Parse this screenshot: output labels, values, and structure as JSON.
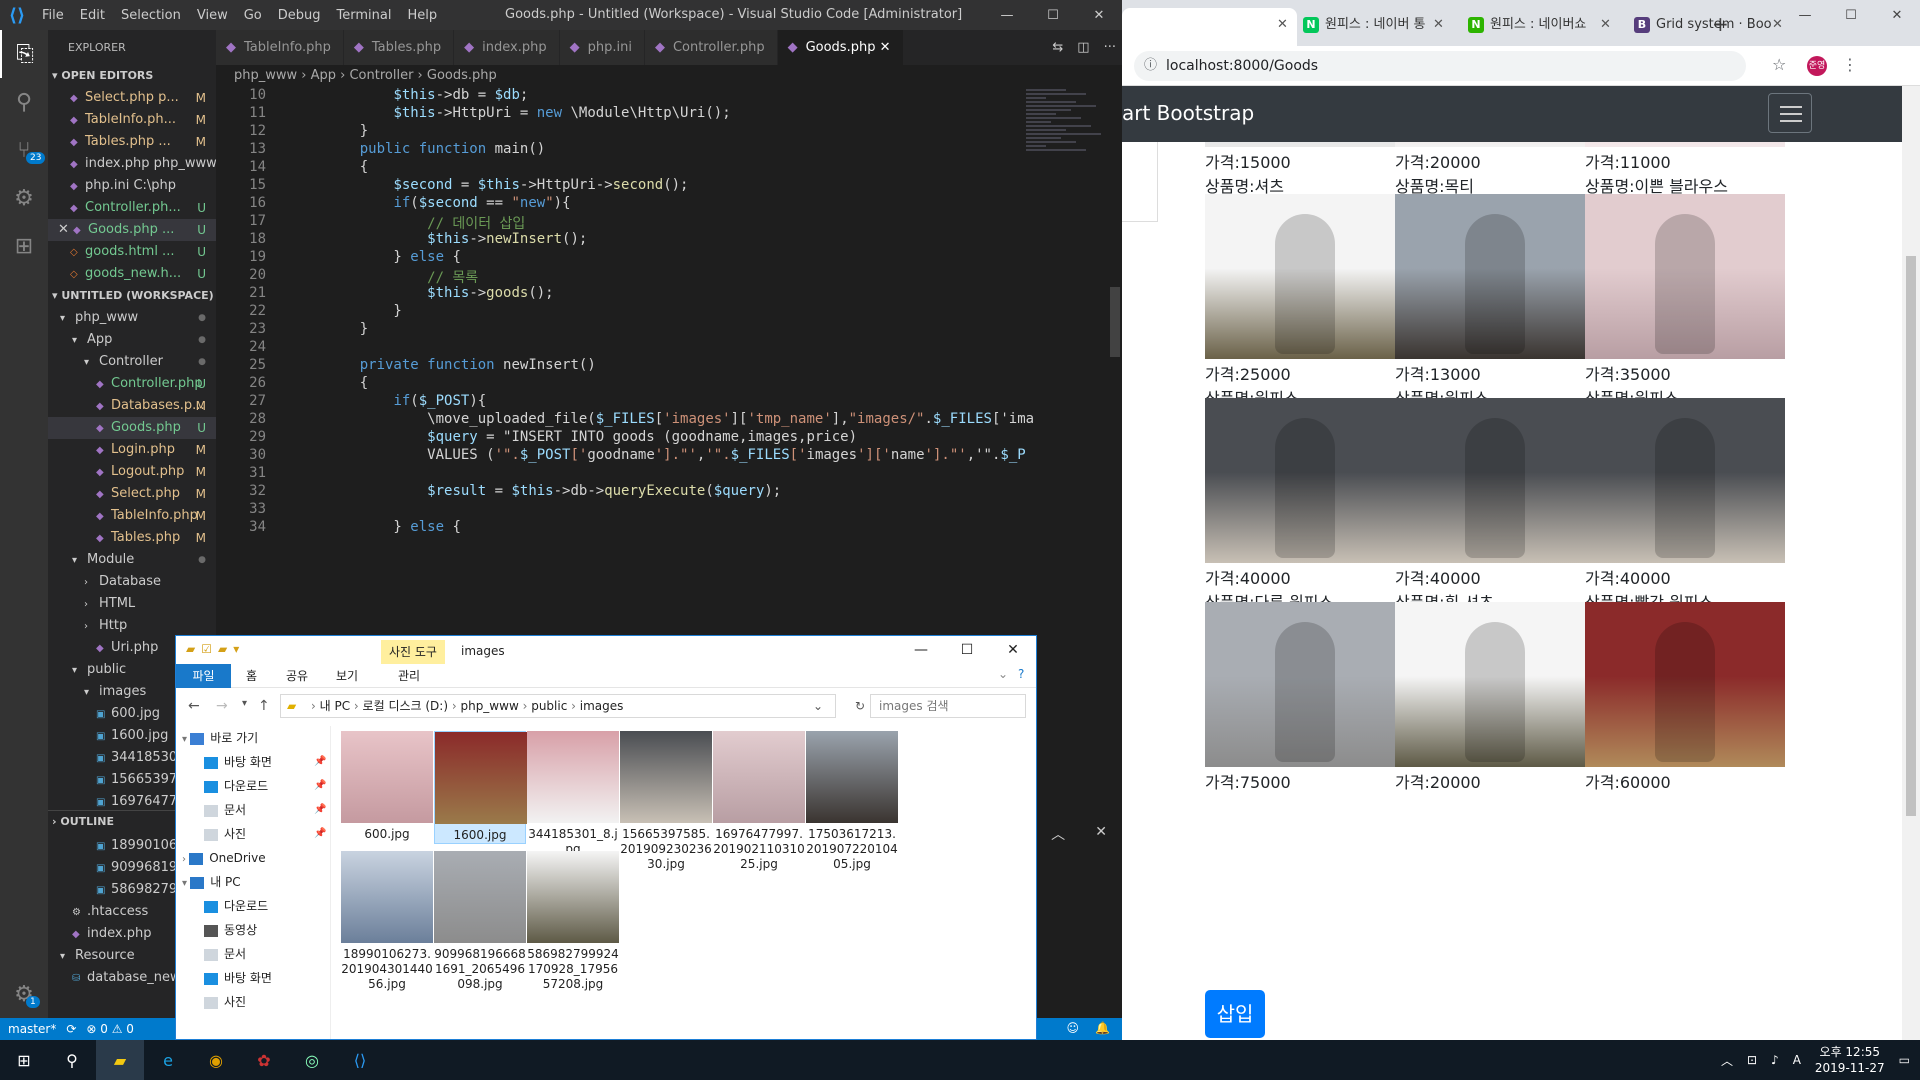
{
  "vscode": {
    "title": "Goods.php - Untitled (Workspace) - Visual Studio Code [Administrator]",
    "menu": [
      "File",
      "Edit",
      "Selection",
      "View",
      "Go",
      "Debug",
      "Terminal",
      "Help"
    ],
    "scm_badge": "23",
    "settings_badge": "1",
    "explorer_label": "EXPLORER",
    "open_editors_label": "OPEN EDITORS",
    "workspace_label": "UNTITLED (WORKSPACE)",
    "outline_label": "OUTLINE",
    "open_editors": [
      {
        "name": "Select.php p...",
        "status": "M",
        "type": "php"
      },
      {
        "name": "TableInfo.ph...",
        "status": "M",
        "type": "php"
      },
      {
        "name": "Tables.php ...",
        "status": "M",
        "type": "php"
      },
      {
        "name": "index.php  php_www...",
        "status": "",
        "type": "php"
      },
      {
        "name": "php.ini  C:\\php",
        "status": "",
        "type": "ini"
      },
      {
        "name": "Controller.ph...",
        "status": "U",
        "type": "php"
      },
      {
        "name": "Goods.php ...",
        "status": "U",
        "type": "php"
      },
      {
        "name": "goods.html ...",
        "status": "U",
        "type": "html"
      },
      {
        "name": "goods_new.h...",
        "status": "U",
        "type": "html"
      }
    ],
    "tree": [
      {
        "name": "php_www",
        "indent": 1,
        "kind": "folder"
      },
      {
        "name": "App",
        "indent": 2,
        "kind": "folder"
      },
      {
        "name": "Controller",
        "indent": 3,
        "kind": "folder"
      },
      {
        "name": "Controller.php",
        "indent": 4,
        "kind": "php",
        "status": "U"
      },
      {
        "name": "Databases.p...",
        "indent": 4,
        "kind": "php",
        "status": "M"
      },
      {
        "name": "Goods.php",
        "indent": 4,
        "kind": "php",
        "status": "U",
        "sel": true
      },
      {
        "name": "Login.php",
        "indent": 4,
        "kind": "php",
        "status": "M"
      },
      {
        "name": "Logout.php",
        "indent": 4,
        "kind": "php",
        "status": "M"
      },
      {
        "name": "Select.php",
        "indent": 4,
        "kind": "php",
        "status": "M"
      },
      {
        "name": "TableInfo.php",
        "indent": 4,
        "kind": "php",
        "status": "M"
      },
      {
        "name": "Tables.php",
        "indent": 4,
        "kind": "php",
        "status": "M"
      },
      {
        "name": "Module",
        "indent": 2,
        "kind": "folder"
      },
      {
        "name": "Database",
        "indent": 3,
        "kind": "folder-c"
      },
      {
        "name": "HTML",
        "indent": 3,
        "kind": "folder-c"
      },
      {
        "name": "Http",
        "indent": 3,
        "kind": "folder-c"
      },
      {
        "name": "Uri.php",
        "indent": 4,
        "kind": "php"
      },
      {
        "name": "public",
        "indent": 2,
        "kind": "folder"
      },
      {
        "name": "images",
        "indent": 3,
        "kind": "folder"
      },
      {
        "name": "600.jpg",
        "indent": 4,
        "kind": "img"
      },
      {
        "name": "1600.jpg",
        "indent": 4,
        "kind": "img"
      },
      {
        "name": "344185301_...",
        "indent": 4,
        "kind": "img"
      },
      {
        "name": "1566539758...",
        "indent": 4,
        "kind": "img"
      },
      {
        "name": "1697647799...",
        "indent": 4,
        "kind": "img"
      },
      {
        "name": "1750361721...",
        "indent": 4,
        "kind": "img"
      },
      {
        "name": "1899010627...",
        "indent": 4,
        "kind": "img"
      },
      {
        "name": "9099681966...",
        "indent": 4,
        "kind": "img"
      },
      {
        "name": "5869827999...",
        "indent": 4,
        "kind": "img"
      },
      {
        "name": ".htaccess",
        "indent": 2,
        "kind": "gear"
      },
      {
        "name": "index.php",
        "indent": 2,
        "kind": "php"
      },
      {
        "name": "Resource",
        "indent": 1,
        "kind": "folder"
      },
      {
        "name": "database_new...",
        "indent": 2,
        "kind": "db"
      }
    ],
    "tabs": [
      {
        "name": "TableInfo.php",
        "active": false
      },
      {
        "name": "Tables.php",
        "active": false
      },
      {
        "name": "index.php",
        "active": false
      },
      {
        "name": "php.ini",
        "active": false
      },
      {
        "name": "Controller.php",
        "active": false
      },
      {
        "name": "Goods.php",
        "active": true
      }
    ],
    "breadcrumb": "php_www › App › Controller › Goods.php",
    "line_numbers": [
      "10",
      "11",
      "12",
      "13",
      "14",
      "15",
      "16",
      "17",
      "18",
      "19",
      "20",
      "21",
      "22",
      "23",
      "24",
      "25",
      "26",
      "27",
      "28",
      "29",
      "30",
      "31",
      "32",
      "33",
      "34"
    ],
    "code": [
      "        $this->db = $db;",
      "        $this->HttpUri = new \\Module\\Http\\Uri();",
      "    }",
      "    public function main()",
      "    {",
      "        $second = $this->HttpUri->second();",
      "        if($second == \"new\"){",
      "            // 데이터 삽입",
      "            $this->newInsert();",
      "        } else {",
      "            // 목록",
      "            $this->goods();",
      "        }",
      "    }",
      "",
      "    private function newInsert()",
      "    {",
      "        if($_POST){",
      "            \\move_uploaded_file($_FILES['images']['tmp_name'],\"images/\".$_FILES['ima",
      "            $query = \"INSERT INTO goods (goodname,images,price)",
      "            VALUES ('\".$_POST['goodname'].\"','\".$_FILES['images']['name'].\"','\".$_P",
      "",
      "            $result = $this->db->queryExecute($query);",
      "",
      "        } else {"
    ],
    "status": {
      "branch": "master*",
      "sync": "⟳",
      "problems": "⊗ 0 ⚠ 0"
    }
  },
  "chrome": {
    "tabs": [
      {
        "title": "",
        "fav": "",
        "color": "#dee1e6"
      },
      {
        "title": "원피스 : 네이버 통",
        "fav": "N",
        "color": "#03c75a"
      },
      {
        "title": "원피스 : 네이버쇼",
        "fav": "N",
        "color": "#2db400"
      },
      {
        "title": "Grid system · Boo",
        "fav": "B",
        "color": "#563d7c"
      }
    ],
    "url": "localhost:8000/Goods",
    "profile": "준영",
    "brand": "art Bootstrap",
    "products": [
      {
        "price": "가격:15000",
        "name": "상품명:셔츠",
        "colors": [
          "#c9d3e0",
          "#e8e8e8"
        ]
      },
      {
        "price": "가격:20000",
        "name": "상품명:목티",
        "colors": [
          "#d8a0a8",
          "#f2f2f2"
        ]
      },
      {
        "price": "가격:11000",
        "name": "상품명:이쁜 블라우스",
        "colors": [
          "#e8c4c8",
          "#f3e8ea"
        ]
      },
      {
        "price": "가격:25000",
        "name": "상품명:원피스",
        "colors": [
          "#f4f4f4",
          "#6a6148"
        ]
      },
      {
        "price": "가격:13000",
        "name": "상품명:원피스",
        "colors": [
          "#9aa3ad",
          "#3a3430"
        ]
      },
      {
        "price": "가격:35000",
        "name": "상품명:원피스",
        "colors": [
          "#e2cccf",
          "#b89ea3"
        ]
      },
      {
        "price": "가격:40000",
        "name": "상품명:다른 원피스",
        "colors": [
          "#4a4d52",
          "#c8c0b5"
        ]
      },
      {
        "price": "가격:40000",
        "name": "상품명:흰 셔츠",
        "colors": [
          "#4a4d52",
          "#c8c0b5"
        ]
      },
      {
        "price": "가격:40000",
        "name": "상품명:빨간 원피스",
        "colors": [
          "#4a4d52",
          "#c8c0b5"
        ]
      },
      {
        "price": "가격:75000",
        "name": "",
        "colors": [
          "#a9adb3",
          "#8c8c8c"
        ]
      },
      {
        "price": "가격:20000",
        "name": "",
        "colors": [
          "#f5f5f5",
          "#5e5a46"
        ]
      },
      {
        "price": "가격:60000",
        "name": "",
        "colors": [
          "#8b2a2a",
          "#b08a5a"
        ]
      }
    ],
    "insert_button": "삽입"
  },
  "file_explorer": {
    "tool_tab": "사진 도구",
    "title": "images",
    "ribbon": [
      "파일",
      "홈",
      "공유",
      "보기",
      "관리"
    ],
    "path": [
      "내 PC",
      "로컬 디스크 (D:)",
      "php_www",
      "public",
      "images"
    ],
    "search_placeholder": "images 검색",
    "nav": [
      {
        "name": "바로 가기",
        "indent": 0,
        "icon": "#3b7fd4",
        "pin": false
      },
      {
        "name": "바탕 화면",
        "indent": 1,
        "icon": "#1a8fe0",
        "pin": true
      },
      {
        "name": "다운로드",
        "indent": 1,
        "icon": "#1a8fe0",
        "pin": true
      },
      {
        "name": "문서",
        "indent": 1,
        "icon": "#cfd6dd",
        "pin": true
      },
      {
        "name": "사진",
        "indent": 1,
        "icon": "#cfd6dd",
        "pin": true
      },
      {
        "name": "OneDrive",
        "indent": 0,
        "icon": "#2a78c8",
        "pin": false
      },
      {
        "name": "내 PC",
        "indent": 0,
        "icon": "#2a78c8",
        "pin": false
      },
      {
        "name": "다운로드",
        "indent": 1,
        "icon": "#1a8fe0",
        "pin": false
      },
      {
        "name": "동영상",
        "indent": 1,
        "icon": "#555",
        "pin": false
      },
      {
        "name": "문서",
        "indent": 1,
        "icon": "#cfd6dd",
        "pin": false
      },
      {
        "name": "바탕 화면",
        "indent": 1,
        "icon": "#1a8fe0",
        "pin": false
      },
      {
        "name": "사진",
        "indent": 1,
        "icon": "#cfd6dd",
        "pin": false
      }
    ],
    "files": [
      {
        "name": "600.jpg",
        "colors": [
          "#e8c4c8",
          "#c59aa0"
        ],
        "sel": false
      },
      {
        "name": "1600.jpg",
        "colors": [
          "#8b2a2a",
          "#9a7a4a"
        ],
        "sel": true
      },
      {
        "name": "344185301_8.jpg",
        "colors": [
          "#d8a0a8",
          "#f2f2f2"
        ],
        "sel": false
      },
      {
        "name": "15665397585.20190923023630.jpg",
        "colors": [
          "#4a4d52",
          "#c8c0b5"
        ],
        "sel": false
      },
      {
        "name": "16976477997.20190211031025.jpg",
        "colors": [
          "#e2cccf",
          "#b89ea3"
        ],
        "sel": false
      },
      {
        "name": "17503617213.20190722010405.jpg",
        "colors": [
          "#9aa3ad",
          "#3a3430"
        ],
        "sel": false
      },
      {
        "name": "18990106273.20190430144056.jpg",
        "colors": [
          "#c9d3e0",
          "#6b7f9a"
        ],
        "sel": false
      },
      {
        "name": "9099681966681691_2065496098.jpg",
        "colors": [
          "#a9adb3",
          "#8c8c8c"
        ],
        "sel": false
      },
      {
        "name": "586982799924170928_1795657208.jpg",
        "colors": [
          "#f5f5f5",
          "#5e5a46"
        ],
        "sel": false
      }
    ]
  },
  "taskbar": {
    "time": "오후 12:55",
    "date": "2019-11-27",
    "ime": "A"
  }
}
